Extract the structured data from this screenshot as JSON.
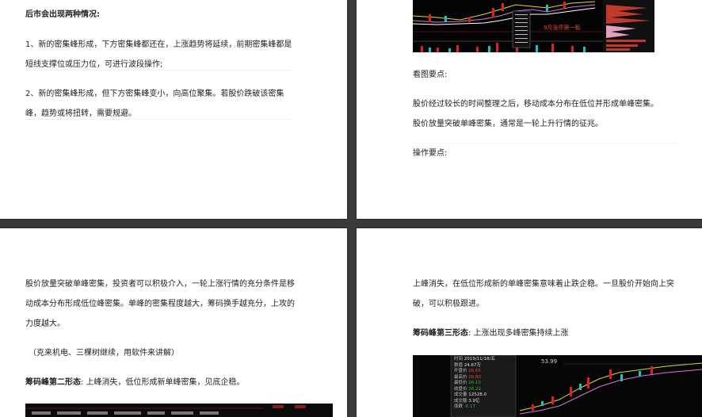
{
  "top_left": {
    "heading": "后市会出现两种情况:",
    "case1": "1、新的密集峰形成，下方密集峰都还在，上涨趋势将延续，前期密集峰都是短线支撑位或压力位，可进行波段操作;",
    "case2": "2、新的密集峰形成，但下方密集峰变小，向高位聚集。若股价跌破该密集峰，趋势或将扭转，需要规避。"
  },
  "top_right": {
    "chart_caption": "9月涨停第一板",
    "see_points": "看图要点:",
    "point1": "股价经过较长的时间整理之后，移动成本分布在低位并形成单峰密集。",
    "point2": "股价放量突破单峰密集，通常是一轮上升行情的征兆。",
    "operation": "操作要点:"
  },
  "bottom_left": {
    "para1": "股价放量突破单峰密集，投资者可以积极介入，一轮上涨行情的充分条件是移动成本分布形成低位峰密集。单峰的密集程度越大，筹码换手越充分，上攻的力度越大。",
    "example": "（克来机电、三棵树继续，用软件来讲解）",
    "form2_label": "筹码峰第二形态",
    "form2_text": ": 上峰消失，低位形成新单峰密集，见底企稳。"
  },
  "bottom_right": {
    "para1": "上峰消失，在低位形成新的单峰密集意味着止跌企稳。一旦股价开始向上突破，可以积极跟进。",
    "form3_label": "筹码峰第三形态",
    "form3_text": ": 上涨出现多峰密集持续上涨",
    "chart_price": "53.99",
    "info_rows": [
      {
        "k": "时间",
        "v": "2019/11/18/五"
      },
      {
        "k": "数值",
        "v": "24.67万"
      },
      {
        "k": "开盘价",
        "v": "26.65"
      },
      {
        "k": "最高价",
        "v": "26.80"
      },
      {
        "k": "最低价",
        "v": "26.10"
      },
      {
        "k": "收盘价",
        "v": "26.22"
      },
      {
        "k": "成交量",
        "v": "12528.0"
      },
      {
        "k": "成交额",
        "v": "3.9亿"
      },
      {
        "k": "涨跌",
        "v": "-0.17"
      }
    ]
  }
}
